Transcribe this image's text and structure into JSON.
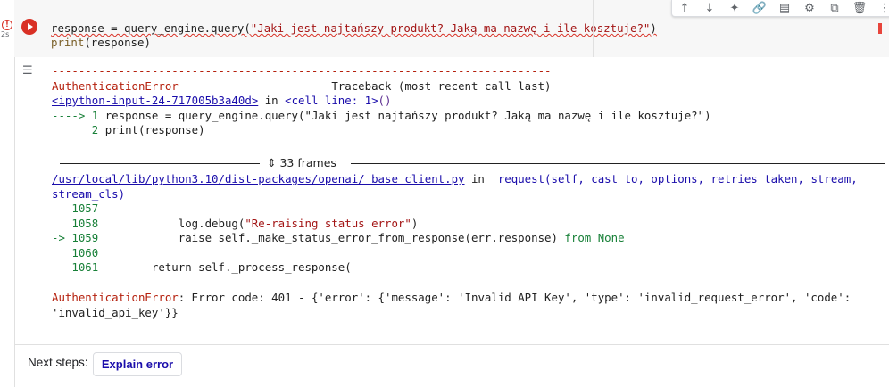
{
  "cell": {
    "exec_marker": "!",
    "exec_time": "2s",
    "code_line1_pre": "response = query_engine.query(",
    "code_line1_str": "\"Jaki jest najtańszy produkt? Jaką ma nazwę i ile kosztuje?\"",
    "code_line1_post": ")",
    "code_line2_fn": "print",
    "code_line2_rest": "(response)"
  },
  "toolbar": {
    "icons": [
      "↑",
      "↓",
      "✦",
      "🔗",
      "▤",
      "⚙",
      "⧉",
      "🗑",
      "⋮"
    ]
  },
  "output": {
    "divider": "---------------------------------------------------------------------------",
    "error_name": "AuthenticationError",
    "traceback_header": "Traceback (most recent call last)",
    "input_link": "<ipython-input-24-717005b3a40d>",
    "in_text": " in ",
    "cell_line": "<cell line: 1>",
    "cell_paren": "()",
    "arrow1": "----> 1 ",
    "line1_code": "response = query_engine.query(\"Jaki jest najtańszy produkt? Jaką ma nazwę i ile kosztuje?\")",
    "line2_num": "      2 ",
    "line2_code": "print(response)",
    "frames_label": "33 frames",
    "file_link": "/usr/local/lib/python3.10/dist-packages/openai/_base_client.py",
    "func_name": "_request",
    "func_args": "(self, cast_to, options, retries_taken, stream,",
    "func_args2": "stream_cls)",
    "l1057": "   1057",
    "l1058": "   1058",
    "l1058_code": "            log.debug(",
    "l1058_str": "\"Re-raising status error\"",
    "l1058_end": ")",
    "l1059_arrow": "-> 1059",
    "l1059_code": "            raise self._make_status_error_from_response(err.response) ",
    "l1059_from": "from None",
    "l1060": "   1060",
    "l1061": "   1061",
    "l1061_code": "        return self._process_response(",
    "final_error_name": "AuthenticationError",
    "final_error_msg": ": Error code: 401 - {'error': {'message': 'Invalid API Key', 'type': 'invalid_request_error', 'code':",
    "final_error_msg2": "'invalid_api_key'}}"
  },
  "next_steps": {
    "label": "Next steps:",
    "button": "Explain error"
  }
}
